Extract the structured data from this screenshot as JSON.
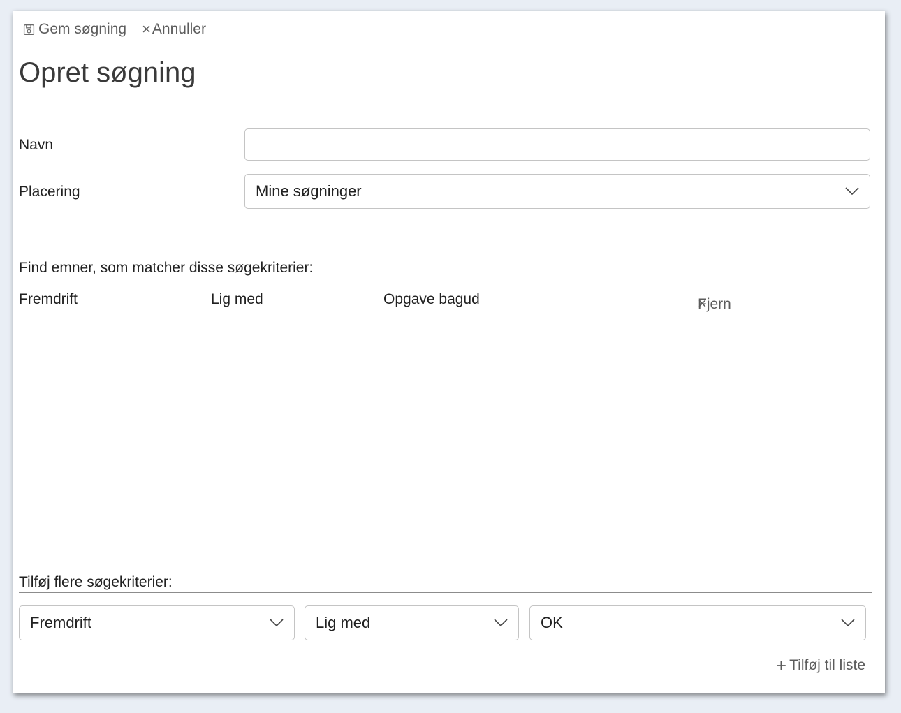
{
  "toolbar": {
    "save_label": "Gem søgning",
    "save_icon": "save-icon",
    "cancel_label": "Annuller",
    "cancel_icon": "close-icon"
  },
  "page_title": "Opret søgning",
  "form": {
    "name_label": "Navn",
    "name_value": "",
    "location_label": "Placering",
    "location_value": "Mine søgninger"
  },
  "criteria": {
    "heading": "Find emner, som matcher disse søgekriterier:",
    "rows": [
      {
        "field": "Fremdrift",
        "operator": "Lig med",
        "value": "Opgave bagud",
        "remove_label": "Fjern"
      }
    ]
  },
  "add_criteria": {
    "heading": "Tilføj flere søgekriterier:",
    "field_value": "Fremdrift",
    "operator_value": "Lig med",
    "value_value": "OK",
    "add_label": "Tilføj til liste",
    "add_icon": "plus-icon"
  },
  "colors": {
    "background": "#e9eef5",
    "panel": "#ffffff",
    "text": "#212121",
    "muted": "#5c5c5c",
    "border": "#c4c4c4"
  }
}
